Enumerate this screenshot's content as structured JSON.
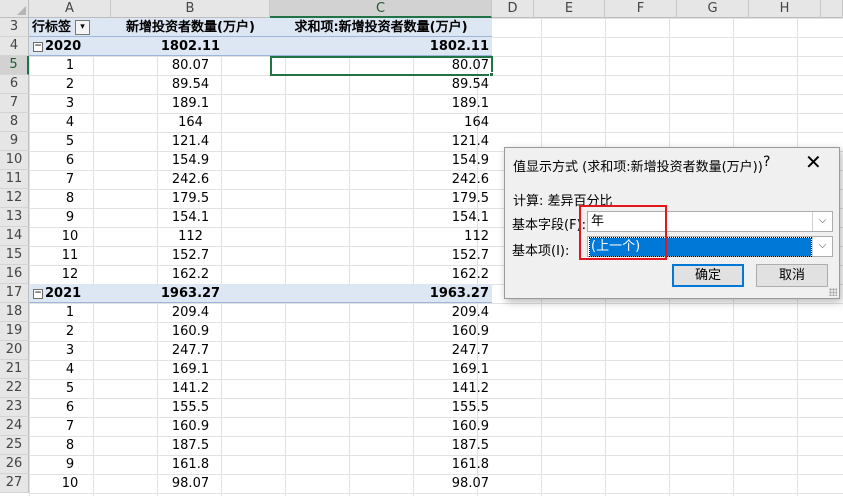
{
  "columns": [
    "A",
    "B",
    "C",
    "D",
    "E",
    "F",
    "G",
    "H"
  ],
  "selected_column": "C",
  "selected_row": "5",
  "header_row": {
    "row": "3",
    "a": "行标签",
    "b": "新增投资者数量(万户)",
    "c": "求和项:新增投资者数量(万户)"
  },
  "rows": [
    {
      "row": "4",
      "a": "2020",
      "b": "1802.11",
      "c": "1802.11",
      "group": true
    },
    {
      "row": "5",
      "a": "1",
      "b": "80.07",
      "c": "80.07"
    },
    {
      "row": "6",
      "a": "2",
      "b": "89.54",
      "c": "89.54"
    },
    {
      "row": "7",
      "a": "3",
      "b": "189.1",
      "c": "189.1"
    },
    {
      "row": "8",
      "a": "4",
      "b": "164",
      "c": "164"
    },
    {
      "row": "9",
      "a": "5",
      "b": "121.4",
      "c": "121.4"
    },
    {
      "row": "10",
      "a": "6",
      "b": "154.9",
      "c": "154.9"
    },
    {
      "row": "11",
      "a": "7",
      "b": "242.6",
      "c": "242.6"
    },
    {
      "row": "12",
      "a": "8",
      "b": "179.5",
      "c": "179.5"
    },
    {
      "row": "13",
      "a": "9",
      "b": "154.1",
      "c": "154.1"
    },
    {
      "row": "14",
      "a": "10",
      "b": "112",
      "c": "112"
    },
    {
      "row": "15",
      "a": "11",
      "b": "152.7",
      "c": "152.7"
    },
    {
      "row": "16",
      "a": "12",
      "b": "162.2",
      "c": "162.2"
    },
    {
      "row": "17",
      "a": "2021",
      "b": "1963.27",
      "c": "1963.27",
      "group": true
    },
    {
      "row": "18",
      "a": "1",
      "b": "209.4",
      "c": "209.4"
    },
    {
      "row": "19",
      "a": "2",
      "b": "160.9",
      "c": "160.9"
    },
    {
      "row": "20",
      "a": "3",
      "b": "247.7",
      "c": "247.7"
    },
    {
      "row": "21",
      "a": "4",
      "b": "169.1",
      "c": "169.1"
    },
    {
      "row": "22",
      "a": "5",
      "b": "141.2",
      "c": "141.2"
    },
    {
      "row": "23",
      "a": "6",
      "b": "155.5",
      "c": "155.5"
    },
    {
      "row": "24",
      "a": "7",
      "b": "160.9",
      "c": "160.9"
    },
    {
      "row": "25",
      "a": "8",
      "b": "187.5",
      "c": "187.5"
    },
    {
      "row": "26",
      "a": "9",
      "b": "161.8",
      "c": "161.8"
    },
    {
      "row": "27",
      "a": "10",
      "b": "98.07",
      "c": "98.07"
    }
  ],
  "dialog": {
    "title": "值显示方式 (求和项:新增投资者数量(万户))",
    "help": "?",
    "close": "✕",
    "calc_label": "计算: 差异百分比",
    "base_field_label": "基本字段(F):",
    "base_field_value": "年",
    "base_item_label": "基本项(I):",
    "base_item_value": "(上一个)",
    "ok_label": "确定",
    "cancel_label": "取消"
  },
  "colors": {
    "selection": "#217346",
    "highlight": "#0078d7",
    "callout": "#e0181b"
  }
}
